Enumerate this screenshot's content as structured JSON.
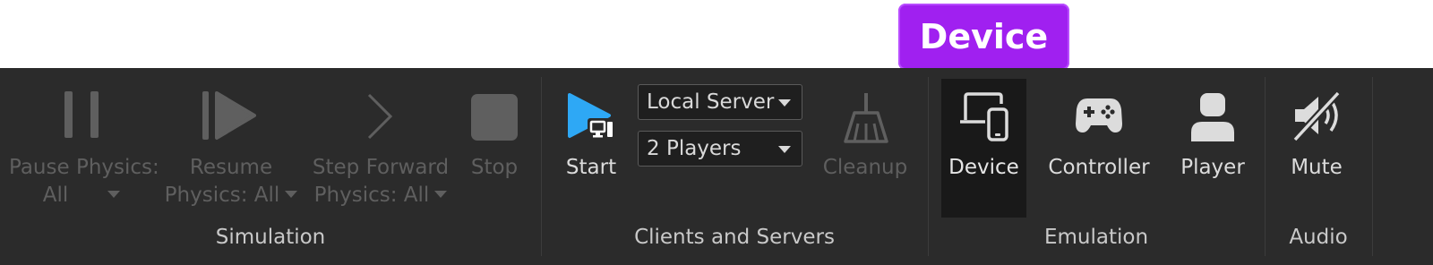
{
  "tooltip": {
    "text": "Device"
  },
  "simulation": {
    "group_label": "Simulation",
    "pause": {
      "line1": "Pause Physics:",
      "line2": "All"
    },
    "resume": {
      "line1": "Resume",
      "line2": "Physics: All"
    },
    "step": {
      "line1": "Step Forward",
      "line2": "Physics: All"
    },
    "stop": {
      "label": "Stop"
    }
  },
  "clients_servers": {
    "group_label": "Clients and Servers",
    "start": {
      "label": "Start"
    },
    "server_select": {
      "value": "Local Server"
    },
    "players_select": {
      "value": "2 Players"
    },
    "cleanup": {
      "label": "Cleanup"
    }
  },
  "emulation": {
    "group_label": "Emulation",
    "device": {
      "label": "Device"
    },
    "controller": {
      "label": "Controller"
    },
    "player": {
      "label": "Player"
    }
  },
  "audio": {
    "group_label": "Audio",
    "mute": {
      "label": "Mute"
    }
  },
  "colors": {
    "toolbar_bg": "#2b2b2b",
    "accent_tooltip": "#a020f0",
    "start_icon": "#2ea8f5",
    "disabled": "#5f5f5f"
  }
}
